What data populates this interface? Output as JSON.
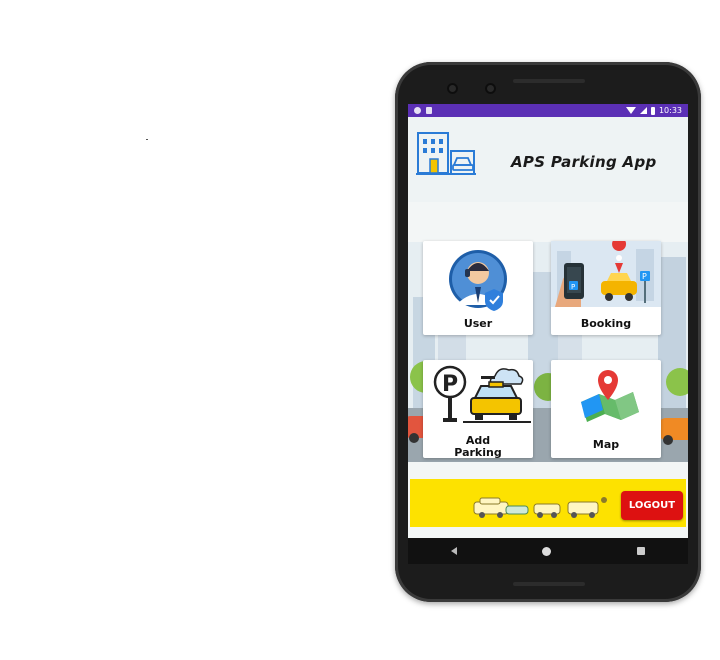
{
  "status_bar": {
    "time": "10:33",
    "icons": [
      "app-icon",
      "card-icon",
      "wifi-icon",
      "signal-icon",
      "battery-icon"
    ]
  },
  "header": {
    "title": "APS Parking App",
    "logo_icon": "building-car-icon"
  },
  "menu": {
    "user_label": "User",
    "booking_label": "Booking",
    "add_parking_label_line1": "Add",
    "add_parking_label_line2": "Parking",
    "map_label": "Map"
  },
  "banner": {
    "logout_label": "LOGOUT"
  },
  "nav": {
    "buttons": [
      "back-icon",
      "home-icon",
      "recents-icon"
    ]
  },
  "colors": {
    "status_bar": "#5b2fb5",
    "banner": "#fde200",
    "logout": "#dd1111",
    "phone_frame": "#1c1c1c"
  }
}
